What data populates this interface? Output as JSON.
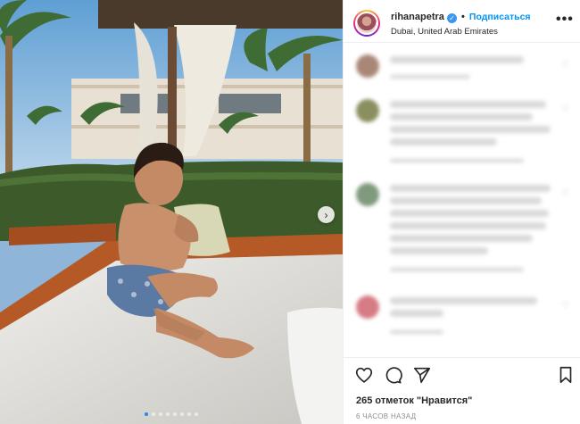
{
  "post": {
    "username": "rihanapetra",
    "follow_label": "Подписаться",
    "separator": "•",
    "location": "Dubai, United Arab Emirates",
    "more_label": "•••",
    "likes_text": "265 отметок \"Нравится\"",
    "time_text": "6 ЧАСОВ НАЗАД"
  },
  "carousel": {
    "total_slides": 8,
    "active_index": 0,
    "next_glyph": "›"
  },
  "icons": {
    "verified": "verified-badge-icon",
    "like": "heart-icon",
    "comment": "comment-bubble-icon",
    "share": "paper-plane-icon",
    "save": "bookmark-icon"
  },
  "colors": {
    "accent": "#0095f6",
    "verified": "#3897f0",
    "text": "#262626",
    "muted": "#8e8e8e"
  }
}
